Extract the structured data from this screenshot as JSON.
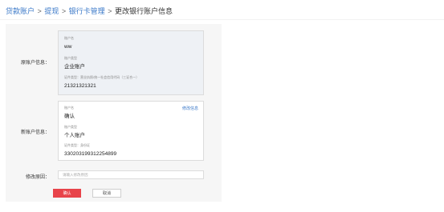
{
  "breadcrumb": {
    "items": [
      "贷款账户",
      "提现",
      "银行卡管理"
    ],
    "separator": ">",
    "current": "更改银行账户信息"
  },
  "original": {
    "section_label": "原账户信息：",
    "name_label": "账户名",
    "name_value": "ww",
    "type_label": "账户类型",
    "type_value": "企业账户",
    "id_label": "证件类型：营业执照/统一社会信用代码（三证合一）",
    "id_value": "21321321321"
  },
  "new_account": {
    "section_label": "新账户信息：",
    "modify_link": "修改信息",
    "name_label": "账户名",
    "name_value": "确认",
    "type_label": "账户类型",
    "type_value": "个人账户",
    "id_label": "证件类型：身份证",
    "id_value": "330203199312254899"
  },
  "reason": {
    "label": "修改原因：",
    "placeholder": "请输入修改原因",
    "value": ""
  },
  "buttons": {
    "confirm": "确认",
    "cancel": "取消"
  },
  "colors": {
    "link": "#3a78c8",
    "confirm_button": "#e8434a",
    "panel_background": "#f6f6f6",
    "original_box_background": "#eef1f5"
  }
}
